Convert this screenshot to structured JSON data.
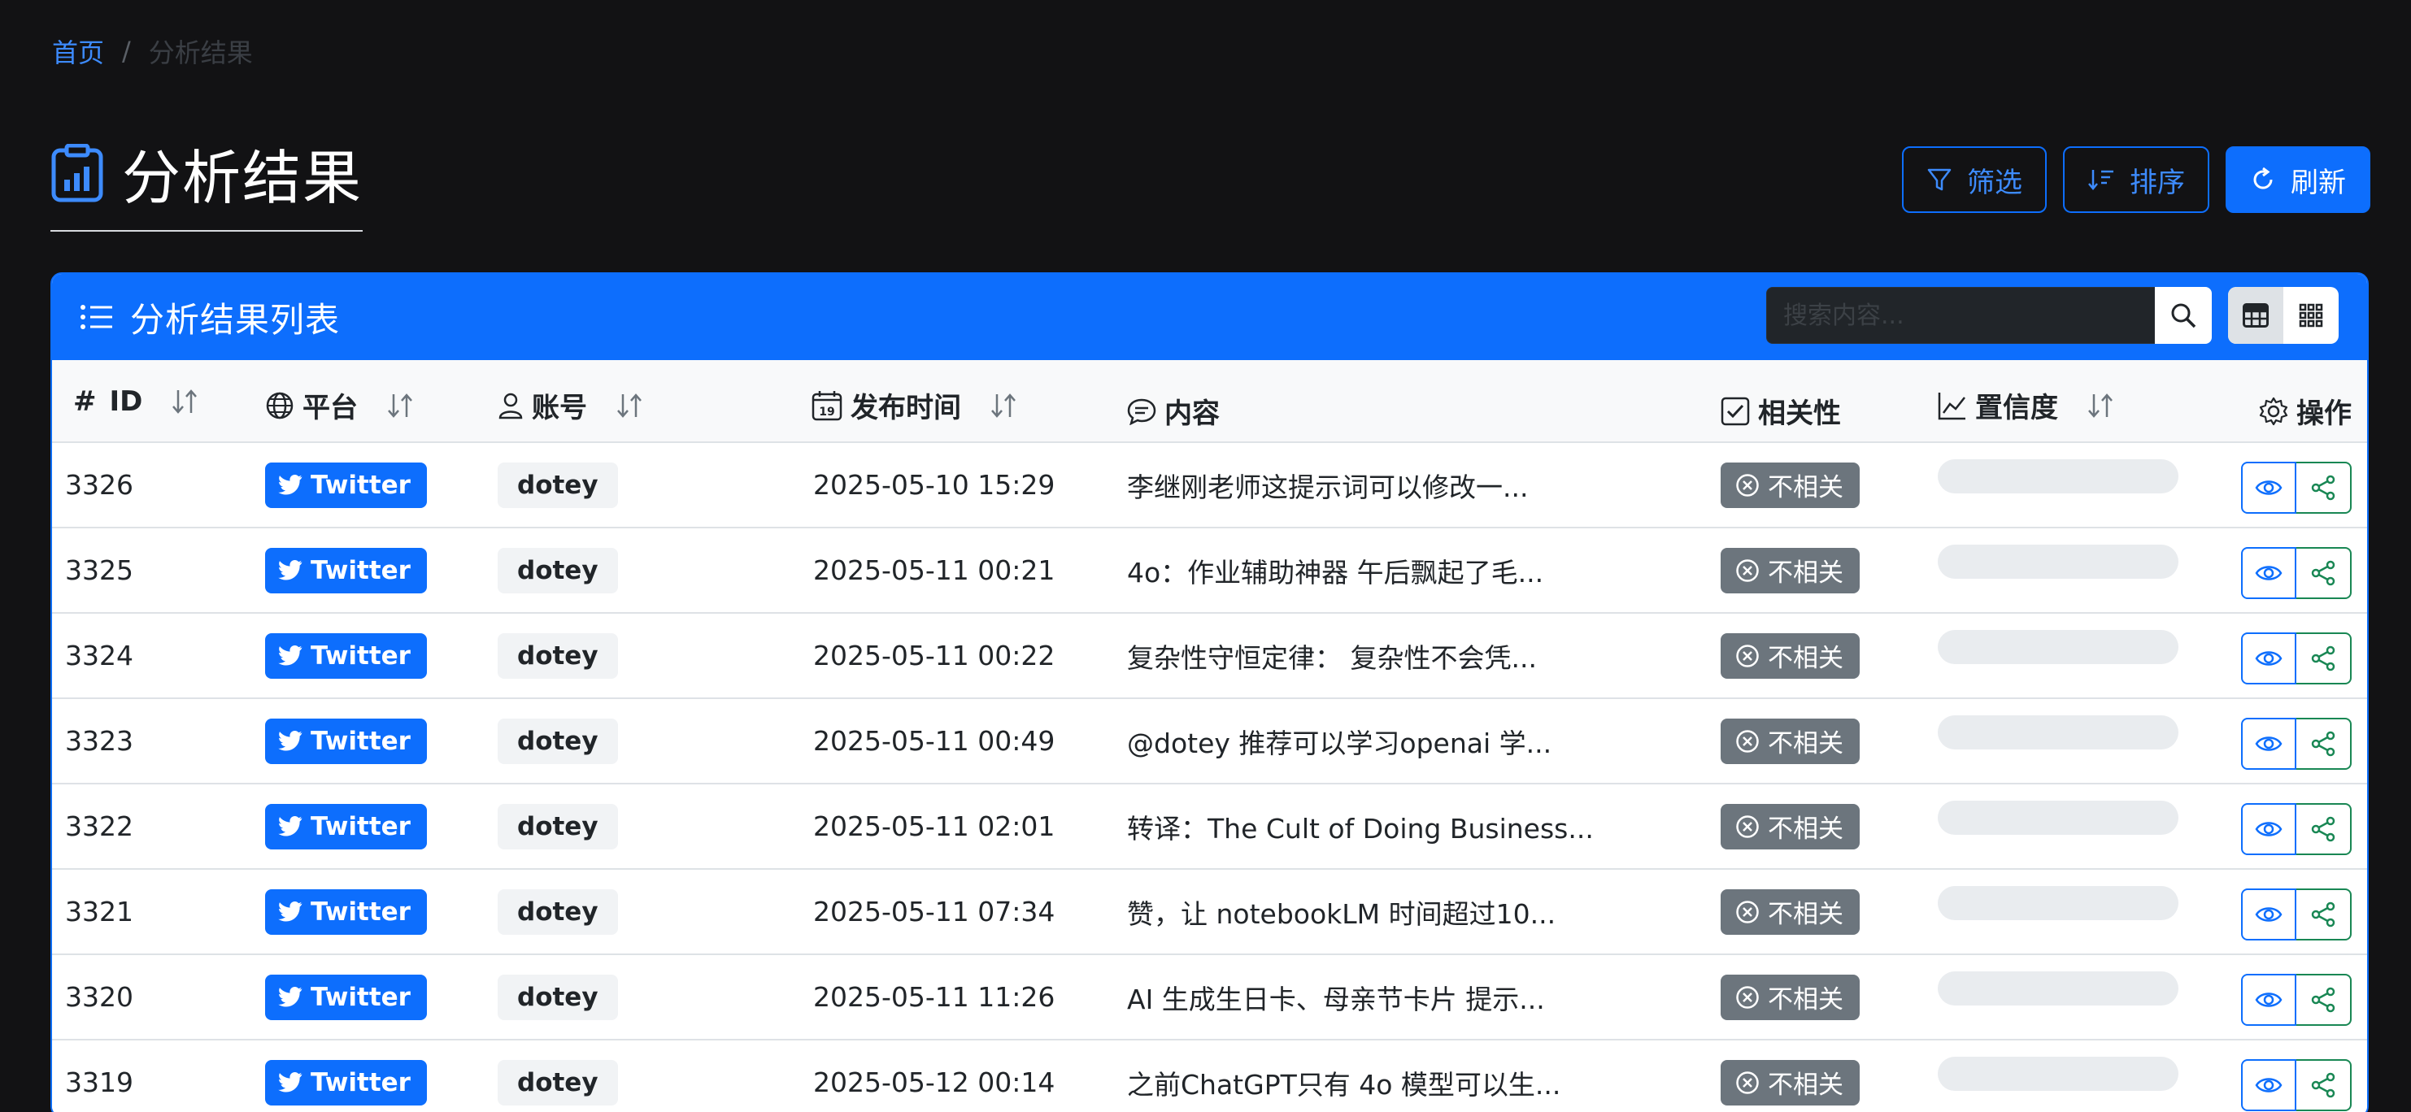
{
  "breadcrumb": {
    "home": "首页",
    "separator": "/",
    "current": "分析结果"
  },
  "page_title": "分析结果",
  "actions": {
    "filter": "筛选",
    "sort": "排序",
    "refresh": "刷新"
  },
  "card": {
    "title": "分析结果列表",
    "search_placeholder": "搜索内容..."
  },
  "columns": {
    "id": "ID",
    "id_prefix": "#",
    "platform": "平台",
    "account": "账号",
    "publish_time": "发布时间",
    "content": "内容",
    "relevance": "相关性",
    "confidence": "置信度",
    "actions": "操作"
  },
  "rows": [
    {
      "id": "3326",
      "platform": "Twitter",
      "account": "dotey",
      "time": "2025-05-10 15:29",
      "content": "李继刚老师这提示词可以修改一...",
      "relevance": "不相关"
    },
    {
      "id": "3325",
      "platform": "Twitter",
      "account": "dotey",
      "time": "2025-05-11 00:21",
      "content": "4o：作业辅助神器 午后飘起了毛...",
      "relevance": "不相关"
    },
    {
      "id": "3324",
      "platform": "Twitter",
      "account": "dotey",
      "time": "2025-05-11 00:22",
      "content": "复杂性守恒定律： 复杂性不会凭...",
      "relevance": "不相关"
    },
    {
      "id": "3323",
      "platform": "Twitter",
      "account": "dotey",
      "time": "2025-05-11 00:49",
      "content": "@dotey 推荐可以学习openai 学...",
      "relevance": "不相关"
    },
    {
      "id": "3322",
      "platform": "Twitter",
      "account": "dotey",
      "time": "2025-05-11 02:01",
      "content": "转译：The Cult of Doing Business...",
      "relevance": "不相关"
    },
    {
      "id": "3321",
      "platform": "Twitter",
      "account": "dotey",
      "time": "2025-05-11 07:34",
      "content": "赞，让 notebookLM 时间超过10...",
      "relevance": "不相关"
    },
    {
      "id": "3320",
      "platform": "Twitter",
      "account": "dotey",
      "time": "2025-05-11 11:26",
      "content": "AI 生成生日卡、母亲节卡片 提示...",
      "relevance": "不相关"
    },
    {
      "id": "3319",
      "platform": "Twitter",
      "account": "dotey",
      "time": "2025-05-12 00:14",
      "content": "之前ChatGPT只有 4o 模型可以生...",
      "relevance": "不相关"
    }
  ],
  "colors": {
    "primary": "#0d6efd",
    "success": "#198754",
    "secondary": "#6c757d",
    "background": "#121214"
  }
}
